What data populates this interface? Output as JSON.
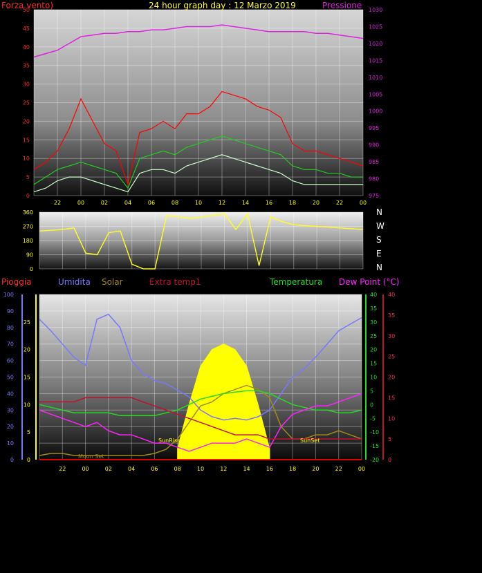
{
  "header": {
    "left_label": "Forza vento)",
    "title": "24 hour graph day : 12 Marzo 2019",
    "right_label": "Pressione"
  },
  "compass": [
    "N",
    "W",
    "S",
    "E",
    "N"
  ],
  "legend": [
    {
      "label": "Pioggia",
      "color": "#ff2a2a"
    },
    {
      "label": "Umidita",
      "color": "#7878ff"
    },
    {
      "label": "Solar",
      "color": "#a08a1a"
    },
    {
      "label": "Extra temp1",
      "color": "#c01030"
    },
    {
      "label": "Temperatura",
      "color": "#22dd22"
    },
    {
      "label": "Dew Point (°C)",
      "color": "#ff22ff"
    }
  ],
  "sun_labels": {
    "sunrise": "SunRise",
    "sunset": "SunSet",
    "moonset": "Moon Set"
  },
  "colors": {
    "wind_gust": "#ff0000",
    "wind_avg": "#22cc22",
    "wind_speed": "#ccffcc",
    "pressure": "#dd22dd",
    "direction": "#ffff22",
    "humidity": "#7878ff",
    "temperature": "#22dd22",
    "dew_point": "#ff22ff",
    "extra_temp": "#c01030",
    "solar": "#ffff00",
    "solar_line": "#a08a1a",
    "rain": "#ff0000",
    "axis_yellow": "#ffff00"
  },
  "chart_data": [
    {
      "type": "line",
      "name": "wind-pressure",
      "xlabels": [
        "22",
        "00",
        "02",
        "04",
        "06",
        "08",
        "10",
        "12",
        "14",
        "16",
        "18",
        "20",
        "22",
        "00"
      ],
      "left_axis": {
        "label": "Forza vento)",
        "ticks": [
          0,
          5,
          10,
          15,
          20,
          25,
          30,
          35,
          40,
          45,
          50
        ],
        "ylim": [
          0,
          50
        ]
      },
      "right_axis": {
        "label": "Pressione",
        "ticks": [
          975,
          980,
          985,
          990,
          995,
          1000,
          1005,
          1010,
          1015,
          1020,
          1025,
          1030
        ],
        "ylim": [
          975,
          1030
        ]
      },
      "x": [
        -4,
        -3,
        -2,
        -1,
        0,
        1,
        2,
        3,
        4,
        5,
        6,
        7,
        8,
        9,
        10,
        11,
        12,
        13,
        14,
        15,
        16,
        17,
        18,
        19,
        20,
        21,
        22,
        23,
        24
      ],
      "series": [
        {
          "values": [
            7,
            9,
            12,
            18,
            26,
            20,
            14,
            12,
            3,
            17,
            18,
            20,
            18,
            22,
            22,
            24,
            28,
            27,
            26,
            24,
            23,
            21,
            14,
            12,
            12,
            11,
            10,
            9,
            8
          ],
          "axis": "left"
        },
        {
          "values": [
            3,
            5,
            7,
            8,
            9,
            8,
            7,
            6,
            2,
            10,
            11,
            12,
            11,
            13,
            14,
            15,
            16,
            15,
            14,
            13,
            12,
            11,
            8,
            7,
            7,
            6,
            6,
            5,
            5
          ],
          "axis": "left"
        },
        {
          "values": [
            1,
            2,
            4,
            5,
            5,
            4,
            3,
            2,
            1,
            6,
            7,
            7,
            6,
            8,
            9,
            10,
            11,
            10,
            9,
            8,
            7,
            6,
            4,
            3,
            3,
            3,
            3,
            3,
            3
          ],
          "axis": "left"
        },
        {
          "values": [
            1016,
            1017,
            1018,
            1020,
            1022,
            1022.5,
            1023,
            1023,
            1023.5,
            1023.5,
            1024,
            1024,
            1024.5,
            1025,
            1025,
            1025,
            1025.5,
            1025,
            1024.5,
            1024,
            1023.5,
            1023.5,
            1023.5,
            1023.5,
            1023,
            1023,
            1022.5,
            1022,
            1021.5
          ],
          "axis": "right"
        }
      ]
    },
    {
      "type": "line",
      "name": "wind-direction",
      "yticks": [
        0,
        90,
        180,
        270,
        360
      ],
      "ylim": [
        0,
        360
      ],
      "x": [
        -4,
        -3,
        -2,
        -1,
        0,
        1,
        2,
        3,
        4,
        5,
        6,
        7,
        8,
        9,
        10,
        11,
        12,
        13,
        14,
        15,
        16,
        17,
        18,
        19,
        20,
        21,
        22,
        23,
        24
      ],
      "values": [
        240,
        245,
        250,
        260,
        100,
        90,
        230,
        240,
        30,
        0,
        0,
        340,
        330,
        320,
        330,
        340,
        350,
        250,
        350,
        20,
        330,
        300,
        280,
        275,
        270,
        265,
        260,
        255,
        250
      ]
    },
    {
      "type": "line",
      "name": "temperature-humidity",
      "xlabels": [
        "22",
        "00",
        "02",
        "04",
        "06",
        "08",
        "10",
        "12",
        "14",
        "16",
        "18",
        "20",
        "22",
        "00"
      ],
      "axes": {
        "humidity": {
          "ticks": [
            0,
            10,
            20,
            30,
            40,
            50,
            60,
            70,
            80,
            90,
            100
          ],
          "ylim": [
            0,
            100
          ]
        },
        "rain": {
          "ticks": [
            0,
            5,
            10,
            15,
            20,
            25
          ],
          "ylim": [
            0,
            30
          ]
        },
        "temperature": {
          "ticks": [
            -20,
            -15,
            -10,
            -5,
            0,
            5,
            10,
            15,
            20,
            25,
            30,
            35,
            40
          ],
          "ylim": [
            -20,
            40
          ]
        },
        "dew_point": {
          "ticks": [
            0,
            5,
            10,
            15,
            20,
            25,
            30,
            35,
            40
          ],
          "ylim": [
            0,
            40
          ]
        }
      },
      "x": [
        -4,
        -3,
        -2,
        -1,
        0,
        1,
        2,
        3,
        4,
        5,
        6,
        7,
        8,
        9,
        10,
        11,
        12,
        13,
        14,
        15,
        16,
        17,
        18,
        19,
        20,
        21,
        22,
        23,
        24
      ],
      "series": [
        {
          "values": [
            85,
            78,
            70,
            62,
            57,
            85,
            88,
            80,
            60,
            52,
            48,
            46,
            42,
            38,
            30,
            26,
            24,
            25,
            24,
            26,
            30,
            40,
            50,
            55,
            62,
            70,
            78,
            82,
            86
          ],
          "axis": "humidity"
        },
        {
          "values": [
            1,
            1.5,
            1.5,
            1,
            1,
            1,
            1,
            1,
            1,
            1,
            1.5,
            2.5,
            5,
            9,
            13,
            14,
            16,
            17,
            18,
            17,
            15,
            8,
            5,
            5,
            6,
            6,
            7,
            6,
            5
          ],
          "axis": "dew_point"
        },
        {
          "values": [
            0,
            0,
            0,
            0,
            0,
            0,
            0,
            0,
            0,
            0,
            0,
            0,
            0,
            0,
            0,
            0,
            0,
            0,
            0,
            0,
            0,
            0,
            0,
            0,
            0,
            0,
            0,
            0,
            0
          ],
          "axis": "rain"
        },
        {
          "values": [
            0,
            0,
            0,
            0,
            0,
            0,
            0,
            0,
            0,
            0,
            0,
            0,
            0,
            0,
            0,
            0,
            0,
            0,
            0,
            0,
            0,
            0,
            0,
            0,
            0,
            0,
            0,
            0,
            0
          ],
          "axis": "rain"
        },
        {
          "values": [
            0,
            -1,
            -2,
            -3,
            -3,
            -3,
            -3,
            -4,
            -4,
            -4,
            -4,
            -3,
            -2,
            0,
            2,
            3,
            4,
            4.5,
            5,
            5,
            4,
            2,
            0,
            -1,
            -2,
            -2,
            -3,
            -3,
            -2
          ],
          "axis": "temperature"
        },
        {
          "values": [
            12,
            11,
            10,
            9,
            8,
            9,
            7,
            6,
            6,
            5,
            4,
            4,
            3,
            2,
            3,
            4,
            4,
            4,
            5,
            4,
            3,
            8,
            11,
            12,
            13,
            13,
            14,
            15,
            16
          ],
          "axis": "dew_point"
        },
        {
          "values": [
            14,
            14,
            14,
            14,
            15,
            15,
            15,
            15,
            15,
            14,
            13,
            12,
            11,
            10,
            9,
            8,
            7,
            6,
            6,
            6,
            5,
            5,
            5,
            5,
            5,
            5,
            5,
            5,
            5
          ],
          "axis": "dew_point"
        }
      ],
      "solar": {
        "x": [
          8,
          9,
          10,
          11,
          12,
          13,
          14,
          15,
          16
        ],
        "values": [
          2,
          10,
          17,
          20,
          21,
          20,
          17,
          10,
          2
        ],
        "axis": "rain"
      }
    }
  ]
}
